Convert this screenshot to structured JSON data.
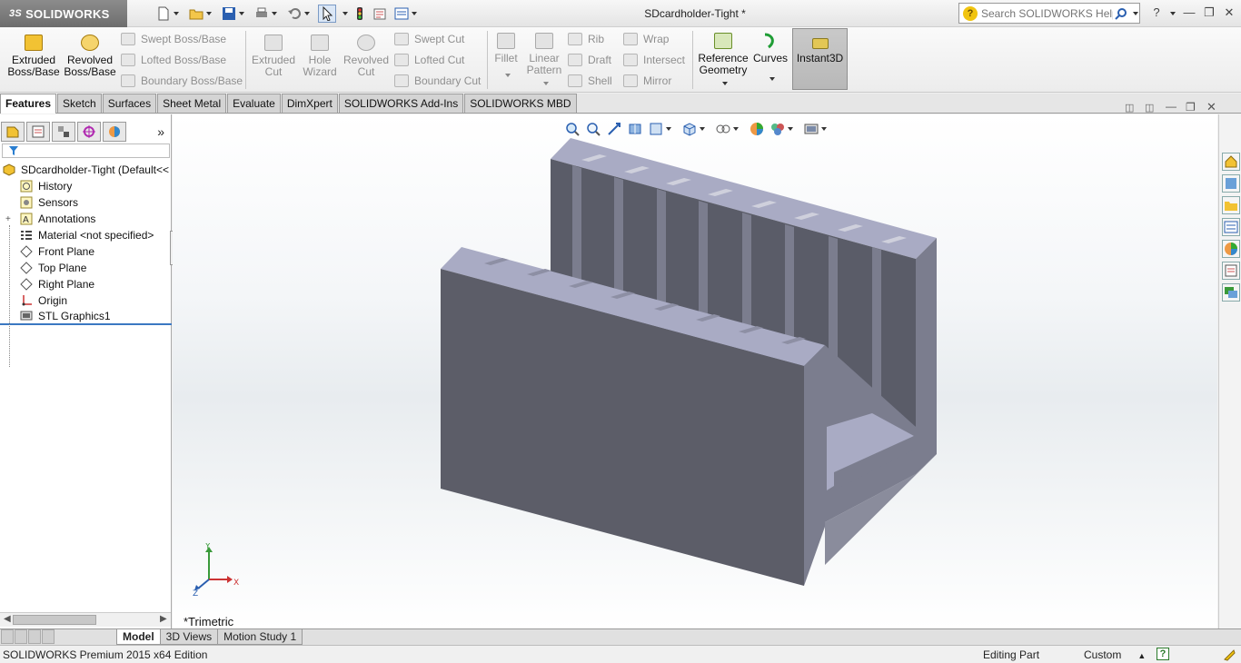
{
  "app": {
    "logo_text": "SOLIDWORKS",
    "logo_prefix": "3S"
  },
  "title": "SDcardholder-Tight *",
  "search": {
    "placeholder": "Search SOLIDWORKS Help"
  },
  "ribbon": {
    "extruded_boss": "Extruded Boss/Base",
    "revolved_boss": "Revolved Boss/Base",
    "swept_boss": "Swept Boss/Base",
    "lofted_boss": "Lofted Boss/Base",
    "boundary_boss": "Boundary Boss/Base",
    "extruded_cut": "Extruded Cut",
    "hole_wizard": "Hole Wizard",
    "revolved_cut": "Revolved Cut",
    "swept_cut": "Swept Cut",
    "lofted_cut": "Lofted Cut",
    "boundary_cut": "Boundary Cut",
    "fillet": "Fillet",
    "linear_pattern": "Linear Pattern",
    "rib": "Rib",
    "draft": "Draft",
    "shell": "Shell",
    "wrap": "Wrap",
    "intersect": "Intersect",
    "mirror": "Mirror",
    "reference_geometry": "Reference Geometry",
    "curves": "Curves",
    "instant3d": "Instant3D"
  },
  "cm_tabs": [
    "Features",
    "Sketch",
    "Surfaces",
    "Sheet Metal",
    "Evaluate",
    "DimXpert",
    "SOLIDWORKS Add-Ins",
    "SOLIDWORKS MBD"
  ],
  "feature_tree": {
    "root": "SDcardholder-Tight  (Default<<",
    "items": [
      "History",
      "Sensors",
      "Annotations",
      "Material <not specified>",
      "Front Plane",
      "Top Plane",
      "Right Plane",
      "Origin",
      "STL Graphics1"
    ]
  },
  "viewport": {
    "view_orientation": "*Trimetric",
    "triad": {
      "x": "X",
      "y": "Y",
      "z": "Z"
    }
  },
  "bottom_tabs": [
    "Model",
    "3D Views",
    "Motion Study 1"
  ],
  "status": {
    "edition": "SOLIDWORKS Premium 2015 x64 Edition",
    "mode": "Editing Part",
    "units": "Custom"
  },
  "colors": {
    "part_front": "#5c5d68",
    "part_top": "#a9abc4",
    "part_side": "#7b7d8e",
    "accent": "#f1c40f"
  }
}
